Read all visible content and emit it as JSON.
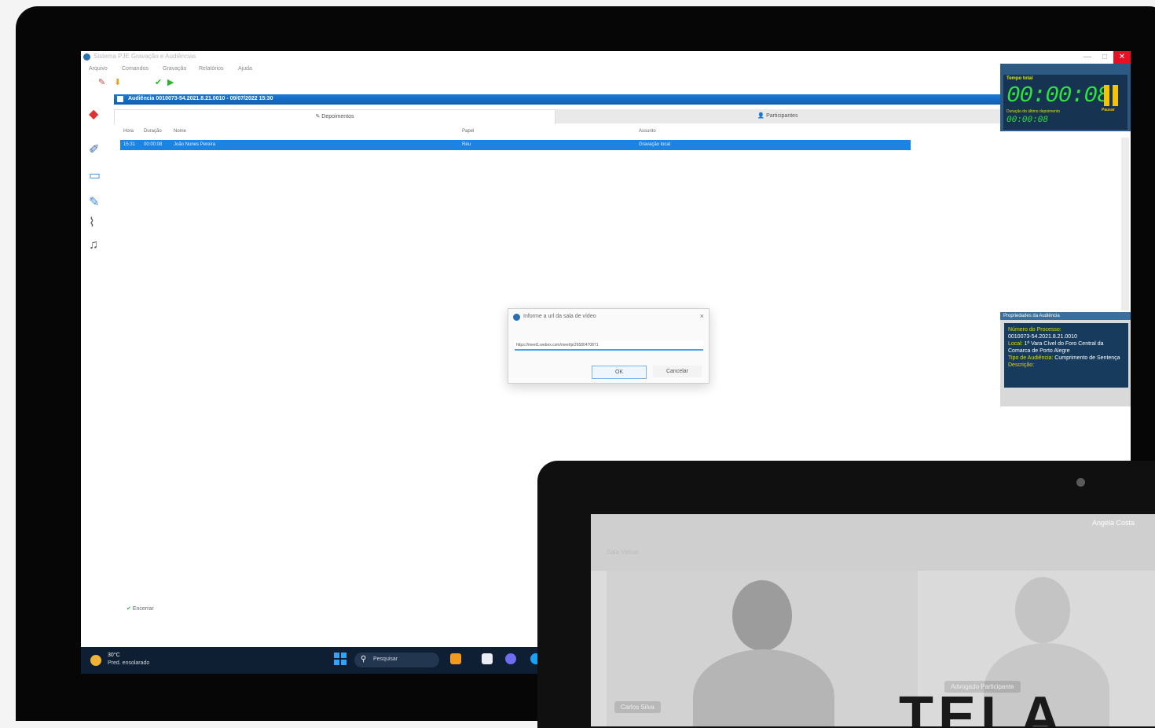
{
  "window": {
    "title": "Sistema PJE Gravação e Audiências",
    "menu": [
      "Arquivo",
      "Comandos",
      "Gravação",
      "Relatórios",
      "Ajuda"
    ],
    "minimize": "—",
    "maximize": "□",
    "close": "✕"
  },
  "session_bar": {
    "label": "Audiência 0010073-54.2021.8.21.0010 - 09/07/2022 15:30"
  },
  "tabs": [
    {
      "label": "Depoimentos",
      "active": true
    },
    {
      "label": "Participantes",
      "active": false
    }
  ],
  "grid": {
    "columns": [
      "Hora",
      "Duração",
      "Nome",
      "Papel",
      "Assunto"
    ],
    "rows": [
      [
        "15:31",
        "00:00:08",
        "João Nunes Pereira",
        "Réu",
        "Gravação local"
      ]
    ]
  },
  "footer": {
    "action_label": "Encerrar"
  },
  "dialog": {
    "title": "Informe a url da sala de vídeo",
    "input_value": "https://meet1.webex.com/meet/pr26580470871",
    "ok_label": "OK",
    "cancel_label": "Cancelar",
    "close": "×"
  },
  "timer": {
    "label": "Tempo total",
    "value": "00:00:08",
    "sub_label": "Duração do último depoimento",
    "sub_value": "00:00:08",
    "pause_label": "Pausar",
    "accent": "#2ee53b"
  },
  "properties": {
    "title": "Propriedades da Audiência",
    "process_label": "Número do Processo:",
    "process_value": "0010073-54.2021.8.21.0010",
    "place_label": "Local:",
    "place_value": "1ª Vara Cível do Foro Central da Comarca de Porto Alegre",
    "type_label": "Tipo de Audiência:",
    "type_value": "Cumprimento de Sentença",
    "description_label": "Descrição:"
  },
  "taskbar": {
    "temperature": "30°C",
    "weather_desc": "Pred. ensolarado",
    "search_placeholder": "Pesquisar"
  },
  "laptop": {
    "host_name": "Angela Costa",
    "room_tab": "Sala Virtual",
    "participant_1": "Carlos Silva",
    "participant_2": "Advogado Participante",
    "brand": "TELA"
  }
}
